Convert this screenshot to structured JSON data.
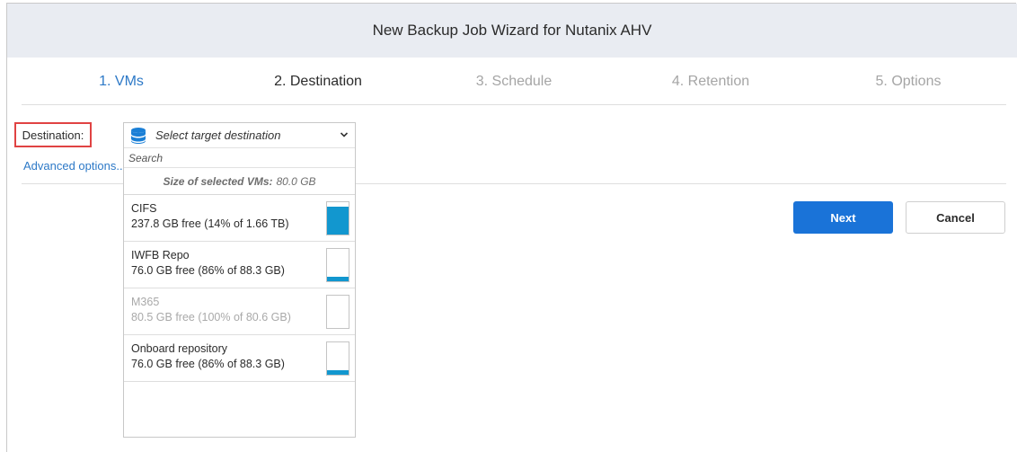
{
  "title": "New Backup Job Wizard for Nutanix AHV",
  "steps": [
    {
      "label": "1. VMs",
      "state": "done"
    },
    {
      "label": "2. Destination",
      "state": "active"
    },
    {
      "label": "3. Schedule",
      "state": "pending"
    },
    {
      "label": "4. Retention",
      "state": "pending"
    },
    {
      "label": "5. Options",
      "state": "pending"
    }
  ],
  "destination": {
    "label": "Destination:",
    "select_placeholder": "Select target destination",
    "search_placeholder": "Search",
    "size_label": "Size of selected VMs:",
    "size_value": "80.0 GB",
    "repositories": [
      {
        "name": "CIFS",
        "free": "237.8 GB free (14% of 1.66 TB)",
        "used_fraction": 0.86,
        "enabled": true
      },
      {
        "name": "IWFB Repo",
        "free": "76.0 GB free (86% of 88.3 GB)",
        "used_fraction": 0.14,
        "enabled": true
      },
      {
        "name": "M365",
        "free": "80.5 GB free (100% of 80.6 GB)",
        "used_fraction": 0.0,
        "enabled": false
      },
      {
        "name": "Onboard repository",
        "free": "76.0 GB free (86% of 88.3 GB)",
        "used_fraction": 0.14,
        "enabled": true
      }
    ]
  },
  "advanced_options": "Advanced options...",
  "buttons": {
    "next": "Next",
    "cancel": "Cancel"
  },
  "colors": {
    "accent": "#1a73d8",
    "meter": "#1297cf",
    "highlight": "#e04343"
  },
  "icons": {
    "destination": "database-icon",
    "select": "chevron-down-icon"
  }
}
